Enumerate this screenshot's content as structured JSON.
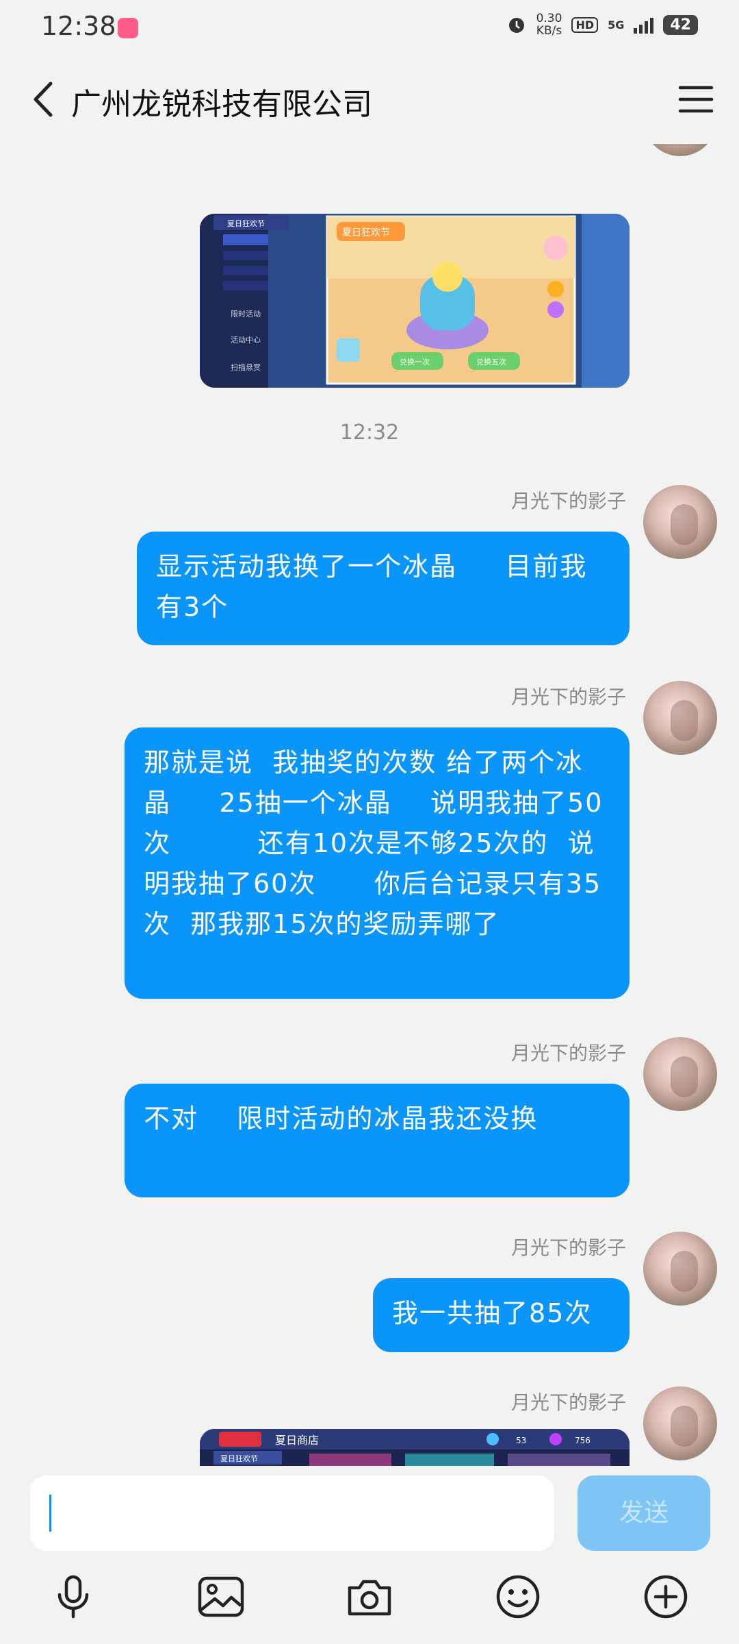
{
  "status_bar": {
    "time": "12:38",
    "net_speed_value": "0.30",
    "net_speed_unit": "KB/s",
    "hd": "HD",
    "network": "5G",
    "battery": "42"
  },
  "header": {
    "title": "广州龙锐科技有限公司"
  },
  "messages": {
    "time_separator": "12:32",
    "items": [
      {
        "sender": "月光下的影子",
        "text": "显示活动我换了一个冰晶     目前我有3个"
      },
      {
        "sender": "月光下的影子",
        "text": "那就是说  我抽奖的次数 给了两个冰晶     25抽一个冰晶    说明我抽了50次         还有10次是不够25次的  说明我抽了60次      你后台记录只有35次  那我那15次的奖励弄哪了"
      },
      {
        "sender": "月光下的影子",
        "text": "不对    限时活动的冰晶我还没换"
      },
      {
        "sender": "月光下的影子",
        "text": "我一共抽了85次"
      },
      {
        "sender": "月光下的影子"
      }
    ],
    "image1": {
      "side_menu": [
        "夏日狂欢节",
        "限时活动",
        "活动中心",
        "扫描悬赏"
      ],
      "banner": "夏日狂欢节",
      "btn1": "兑换一次",
      "btn2": "兑换五次"
    },
    "image2": {
      "header": "夏日商店",
      "menu": "夏日狂欢节",
      "val1": "53",
      "val2": "756"
    }
  },
  "input_bar": {
    "placeholder": "",
    "send_label": "发送"
  },
  "colors": {
    "bubble": "#0a95fb",
    "send_disabled": "#7ec5f6",
    "background": "#f2f2f2"
  },
  "icons": [
    "back-icon",
    "menu-icon",
    "microphone-icon",
    "image-icon",
    "camera-icon",
    "emoji-icon",
    "plus-icon"
  ]
}
